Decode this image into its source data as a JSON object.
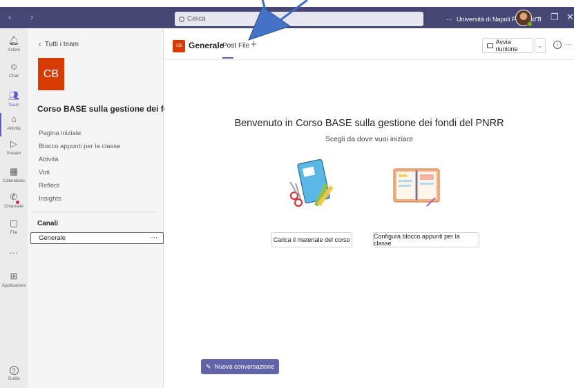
{
  "window": {
    "nav_arrows": "‹ ›",
    "search_placeholder": "Cerca",
    "org_more": "···",
    "org_name": "Università di Napoli Federico II",
    "minimize": "–",
    "restore": "❐",
    "close": "✕"
  },
  "rail": [
    {
      "label": "Azioni",
      "icon": "bell-icon",
      "glyph": "🔔︎"
    },
    {
      "label": "Chat",
      "icon": "chat-icon",
      "glyph": "☺"
    },
    {
      "label": "Team",
      "icon": "teams-icon",
      "glyph": "👥︎"
    },
    {
      "label": "Attività",
      "icon": "backpack-icon",
      "glyph": "⌂"
    },
    {
      "label": "Stream",
      "icon": "stream-icon",
      "glyph": "▷"
    },
    {
      "label": "Calendario",
      "icon": "calendar-icon",
      "glyph": "▦"
    },
    {
      "label": "Chiamate",
      "icon": "phone-icon",
      "glyph": "✆"
    },
    {
      "label": "File",
      "icon": "file-icon",
      "glyph": "▢"
    },
    {
      "label": "",
      "icon": "more-icon",
      "glyph": "···"
    },
    {
      "label": "Applicazioni",
      "icon": "apps-icon",
      "glyph": "⊞"
    },
    {
      "label": "Guida",
      "icon": "help-icon",
      "glyph": "?"
    }
  ],
  "panel": {
    "back_label": "Tutti i team",
    "tile_initials": "CB",
    "team_name": "Corso BASE sulla gestione dei fo...",
    "team_more": "···",
    "menu": [
      "Pagina iniziale",
      "Blocco appunti per la classe",
      "Attività",
      "Voti",
      "Reflect",
      "Insights"
    ],
    "channels_heading": "Canali",
    "channel": "Generale",
    "channel_more": "···"
  },
  "main": {
    "channel_icon_text": "CB",
    "channel_title": "Generale",
    "tabs": [
      "Post",
      "File"
    ],
    "add_tab": "+",
    "meet_button": "Avvia riunione",
    "meet_dropdown": "⌄",
    "info": "i",
    "more": "···",
    "welcome": "Benvenuto in Corso BASE sulla gestione dei fondi del PNRR",
    "subtitle": "Scegli da dove vuoi iniziare",
    "upload_button": "Carica il materiale del corso",
    "notebook_button": "Configura blocco appunti per la classe",
    "new_conversation": "Nuova conversazione"
  },
  "colors": {
    "titlebar": "#464775",
    "accent": "#5b5fc7",
    "team_tile": "#d83b01",
    "new_conv": "#6264a7"
  }
}
